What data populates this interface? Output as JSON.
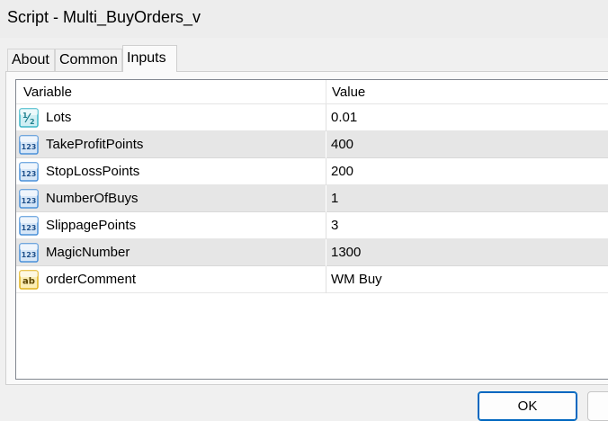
{
  "window": {
    "title": "Script - Multi_BuyOrders_v"
  },
  "tabs": [
    {
      "label": "About"
    },
    {
      "label": "Common"
    },
    {
      "label": "Inputs",
      "active": true
    }
  ],
  "grid": {
    "columns": [
      "Variable",
      "Value"
    ],
    "rows": [
      {
        "icon": "fraction-type-icon",
        "name": "Lots",
        "value": "0.01"
      },
      {
        "icon": "integer-type-icon",
        "name": "TakeProfitPoints",
        "value": "400"
      },
      {
        "icon": "integer-type-icon",
        "name": "StopLossPoints",
        "value": "200"
      },
      {
        "icon": "integer-type-icon",
        "name": "NumberOfBuys",
        "value": "1"
      },
      {
        "icon": "integer-type-icon",
        "name": "SlippagePoints",
        "value": "3"
      },
      {
        "icon": "integer-type-icon",
        "name": "MagicNumber",
        "value": "1300"
      },
      {
        "icon": "string-type-icon",
        "name": "orderComment",
        "value": "WM Buy"
      }
    ]
  },
  "buttons": {
    "ok_label": "OK",
    "cancel_label": ""
  },
  "colors": {
    "integer_icon": "#4a90d9",
    "fraction_icon": "#3bb6c7",
    "string_icon": "#e0b21c",
    "ok_border": "#0067c0"
  }
}
